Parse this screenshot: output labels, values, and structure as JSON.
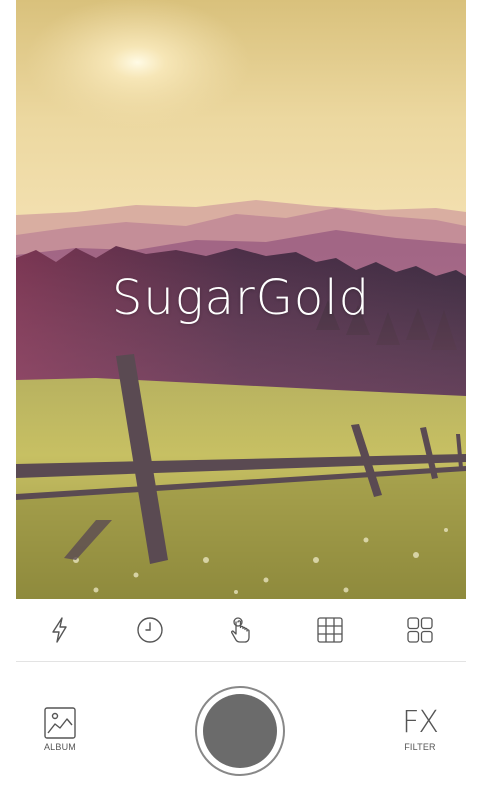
{
  "viewfinder": {
    "filter_name": "SugarGold"
  },
  "toolbar": {
    "icons": [
      "flash-icon",
      "timer-icon",
      "touch-shutter-icon",
      "grid-icon",
      "layout-icon"
    ]
  },
  "bottom": {
    "album_label": "ALBUM",
    "filter_glyph": "FX",
    "filter_label": "FILTER"
  },
  "colors": {
    "icon": "#555555",
    "shutter": "#6b6b6b",
    "divider": "#e3e3e3"
  }
}
